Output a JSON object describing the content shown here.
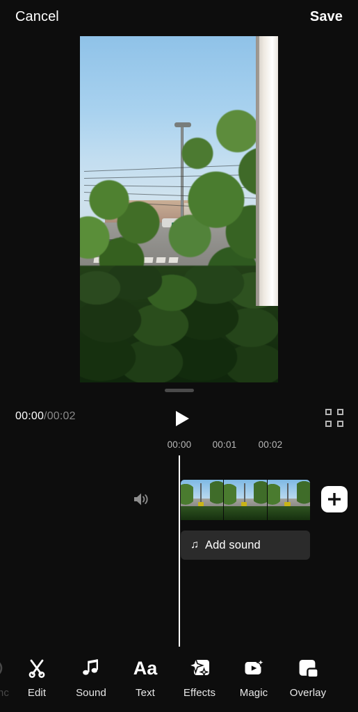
{
  "topbar": {
    "cancel_label": "Cancel",
    "save_label": "Save"
  },
  "preview": {
    "drag_handle": "drag-handle"
  },
  "transport": {
    "current_time": "00:00",
    "separator": "/",
    "duration": "00:02",
    "play_icon": "play-icon",
    "fullscreen_icon": "fullscreen-icon"
  },
  "timeline": {
    "ruler_ticks": [
      "00:00",
      "00:01",
      "00:02"
    ],
    "playhead_position": "00:00",
    "volume_icon": "volume-icon",
    "video_clip": {
      "frame_count": 3
    },
    "sound_track": {
      "icon": "music-note-icon",
      "note_glyph": "♫",
      "label": "Add sound"
    },
    "add_button": {
      "icon": "plus-icon",
      "glyph": "+"
    }
  },
  "toolbar": {
    "items": [
      {
        "label": "d sync",
        "icon": "sound-sync-icon",
        "partial": true
      },
      {
        "label": "Edit",
        "icon": "scissors-icon"
      },
      {
        "label": "Sound",
        "icon": "music-note-icon"
      },
      {
        "label": "Text",
        "icon": "text-aa-icon",
        "glyph": "Aa"
      },
      {
        "label": "Effects",
        "icon": "sparkle-effects-icon"
      },
      {
        "label": "Magic",
        "icon": "magic-wand-icon"
      },
      {
        "label": "Overlay",
        "icon": "overlay-layers-icon"
      }
    ]
  },
  "colors": {
    "background": "#0d0d0d",
    "accent_white": "#ffffff",
    "muted_text": "#8a8a8a",
    "track_bg": "#2b2b2b"
  }
}
